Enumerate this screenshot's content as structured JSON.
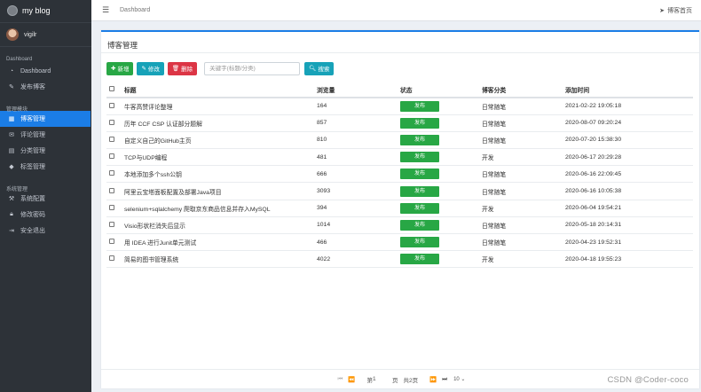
{
  "brand": {
    "title": "my blog"
  },
  "user": {
    "name": "vigilr"
  },
  "sidebar": {
    "sections": [
      {
        "header": "Dashboard",
        "items": [
          {
            "label": "Dashboard",
            "icon": "speedometer-icon"
          },
          {
            "label": "发布博客",
            "icon": "edit-icon"
          }
        ]
      },
      {
        "header": "管理模块",
        "items": [
          {
            "label": "博客管理",
            "icon": "table-icon",
            "active": true
          },
          {
            "label": "评论管理",
            "icon": "comments-icon"
          },
          {
            "label": "分类管理",
            "icon": "folder-icon"
          },
          {
            "label": "标签管理",
            "icon": "tags-icon"
          }
        ]
      },
      {
        "header": "系统管理",
        "items": [
          {
            "label": "系统配置",
            "icon": "wrench-icon"
          },
          {
            "label": "修改密码",
            "icon": "lock-icon"
          },
          {
            "label": "安全退出",
            "icon": "logout-icon"
          }
        ]
      }
    ]
  },
  "header": {
    "breadcrumb": "Dashboard",
    "home_link": "博客首页"
  },
  "card": {
    "title": "博客管理"
  },
  "toolbar": {
    "add_label": "新增",
    "edit_label": "修改",
    "delete_label": "删除",
    "search_placeholder": "关键字(标题/分类)",
    "search_label": "搜索"
  },
  "table": {
    "columns": [
      "标题",
      "浏览量",
      "状态",
      "博客分类",
      "添加时间"
    ],
    "rows": [
      {
        "title": "牛客高赞评论整理",
        "views": "164",
        "status": "发布",
        "category": "日常随笔",
        "time": "2021-02-22 19:05:18"
      },
      {
        "title": "历年 CCF CSP 认证部分题解",
        "views": "857",
        "status": "发布",
        "category": "日常随笔",
        "time": "2020-08-07 09:20:24"
      },
      {
        "title": "自定义自己的GitHub主页",
        "views": "810",
        "status": "发布",
        "category": "日常随笔",
        "time": "2020-07-20 15:38:30"
      },
      {
        "title": "TCP与UDP编程",
        "views": "481",
        "status": "发布",
        "category": "开发",
        "time": "2020-06-17 20:29:28"
      },
      {
        "title": "本地添加多个ssh公钥",
        "views": "666",
        "status": "发布",
        "category": "日常随笔",
        "time": "2020-06-16 22:09:45"
      },
      {
        "title": "阿里云宝塔面板配置及部署Java项目",
        "views": "3093",
        "status": "发布",
        "category": "日常随笔",
        "time": "2020-06-16 10:05:38"
      },
      {
        "title": "selenium+sqlalchemy 爬取京东商品信息并存入MySQL",
        "views": "394",
        "status": "发布",
        "category": "开发",
        "time": "2020-06-04 19:54:21"
      },
      {
        "title": "Visio形状栏消失后显示",
        "views": "1014",
        "status": "发布",
        "category": "日常随笔",
        "time": "2020-05-18 20:14:31"
      },
      {
        "title": "用 IDEA 进行Junit单元测试",
        "views": "466",
        "status": "发布",
        "category": "日常随笔",
        "time": "2020-04-23 19:52:31"
      },
      {
        "title": "简易的图书管理系统",
        "views": "4022",
        "status": "发布",
        "category": "开发",
        "time": "2020-04-18 19:55:23"
      }
    ]
  },
  "pager": {
    "first": "⏮",
    "prev": "⏪",
    "page_prefix": "第",
    "current": "1",
    "page_suffix": "页",
    "total": "共2页",
    "next": "⏩",
    "last": "⏭",
    "page_size": "10"
  },
  "watermark": "CSDN @Coder-coco",
  "colors": {
    "primary": "#1b7de6",
    "success": "#28a745",
    "info": "#17a2b8",
    "danger": "#dc3545",
    "sidebar": "#2d3238"
  }
}
